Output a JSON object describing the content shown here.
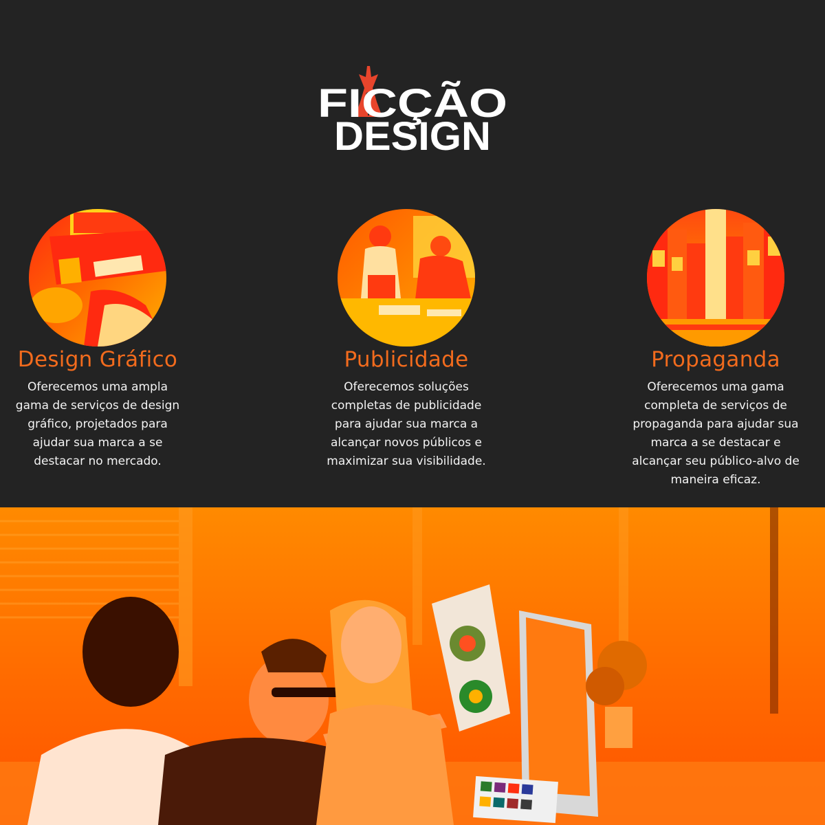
{
  "logo": {
    "line1": "FICÇÃO",
    "line2": "DESIGN",
    "pen_color": "#e8452c"
  },
  "colors": {
    "background": "#232323",
    "accent": "#f26b1d",
    "text": "#f3f3f3"
  },
  "services": [
    {
      "title": "Design Gráfico",
      "description": "Oferecemos uma ampla gama de serviços de design gráfico, projetados para ajudar sua marca a se destacar no mercado.",
      "image": "designer-desk-photo"
    },
    {
      "title": "Publicidade",
      "description": "Oferecemos soluções completas de publicidade para ajudar sua marca a alcançar novos públicos e maximizar sua visibilidade.",
      "image": "team-meeting-photo"
    },
    {
      "title": "Propaganda",
      "description": "Oferecemos uma gama completa de serviços de propaganda para ajudar sua marca a se destacar e alcançar seu público-alvo de maneira eficaz.",
      "image": "city-billboards-photo"
    }
  ],
  "hero": {
    "image": "team-at-computer-photo"
  }
}
